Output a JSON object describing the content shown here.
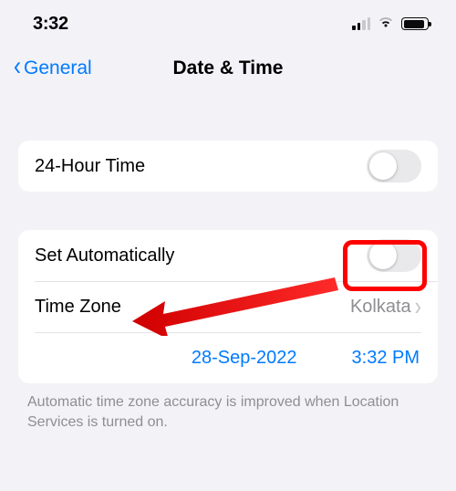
{
  "status": {
    "time": "3:32"
  },
  "nav": {
    "back_label": "General",
    "title": "Date & Time"
  },
  "group1": {
    "row0": {
      "label": "24-Hour Time",
      "toggle": false
    }
  },
  "group2": {
    "row0": {
      "label": "Set Automatically",
      "toggle": false
    },
    "row1": {
      "label": "Time Zone",
      "value": "Kolkata"
    },
    "row2": {
      "date": "28-Sep-2022",
      "time": "3:32 PM"
    }
  },
  "footer": "Automatic time zone accuracy is improved when Location Services is turned on.",
  "colors": {
    "accent": "#007aff",
    "annotation": "#ff0000"
  }
}
